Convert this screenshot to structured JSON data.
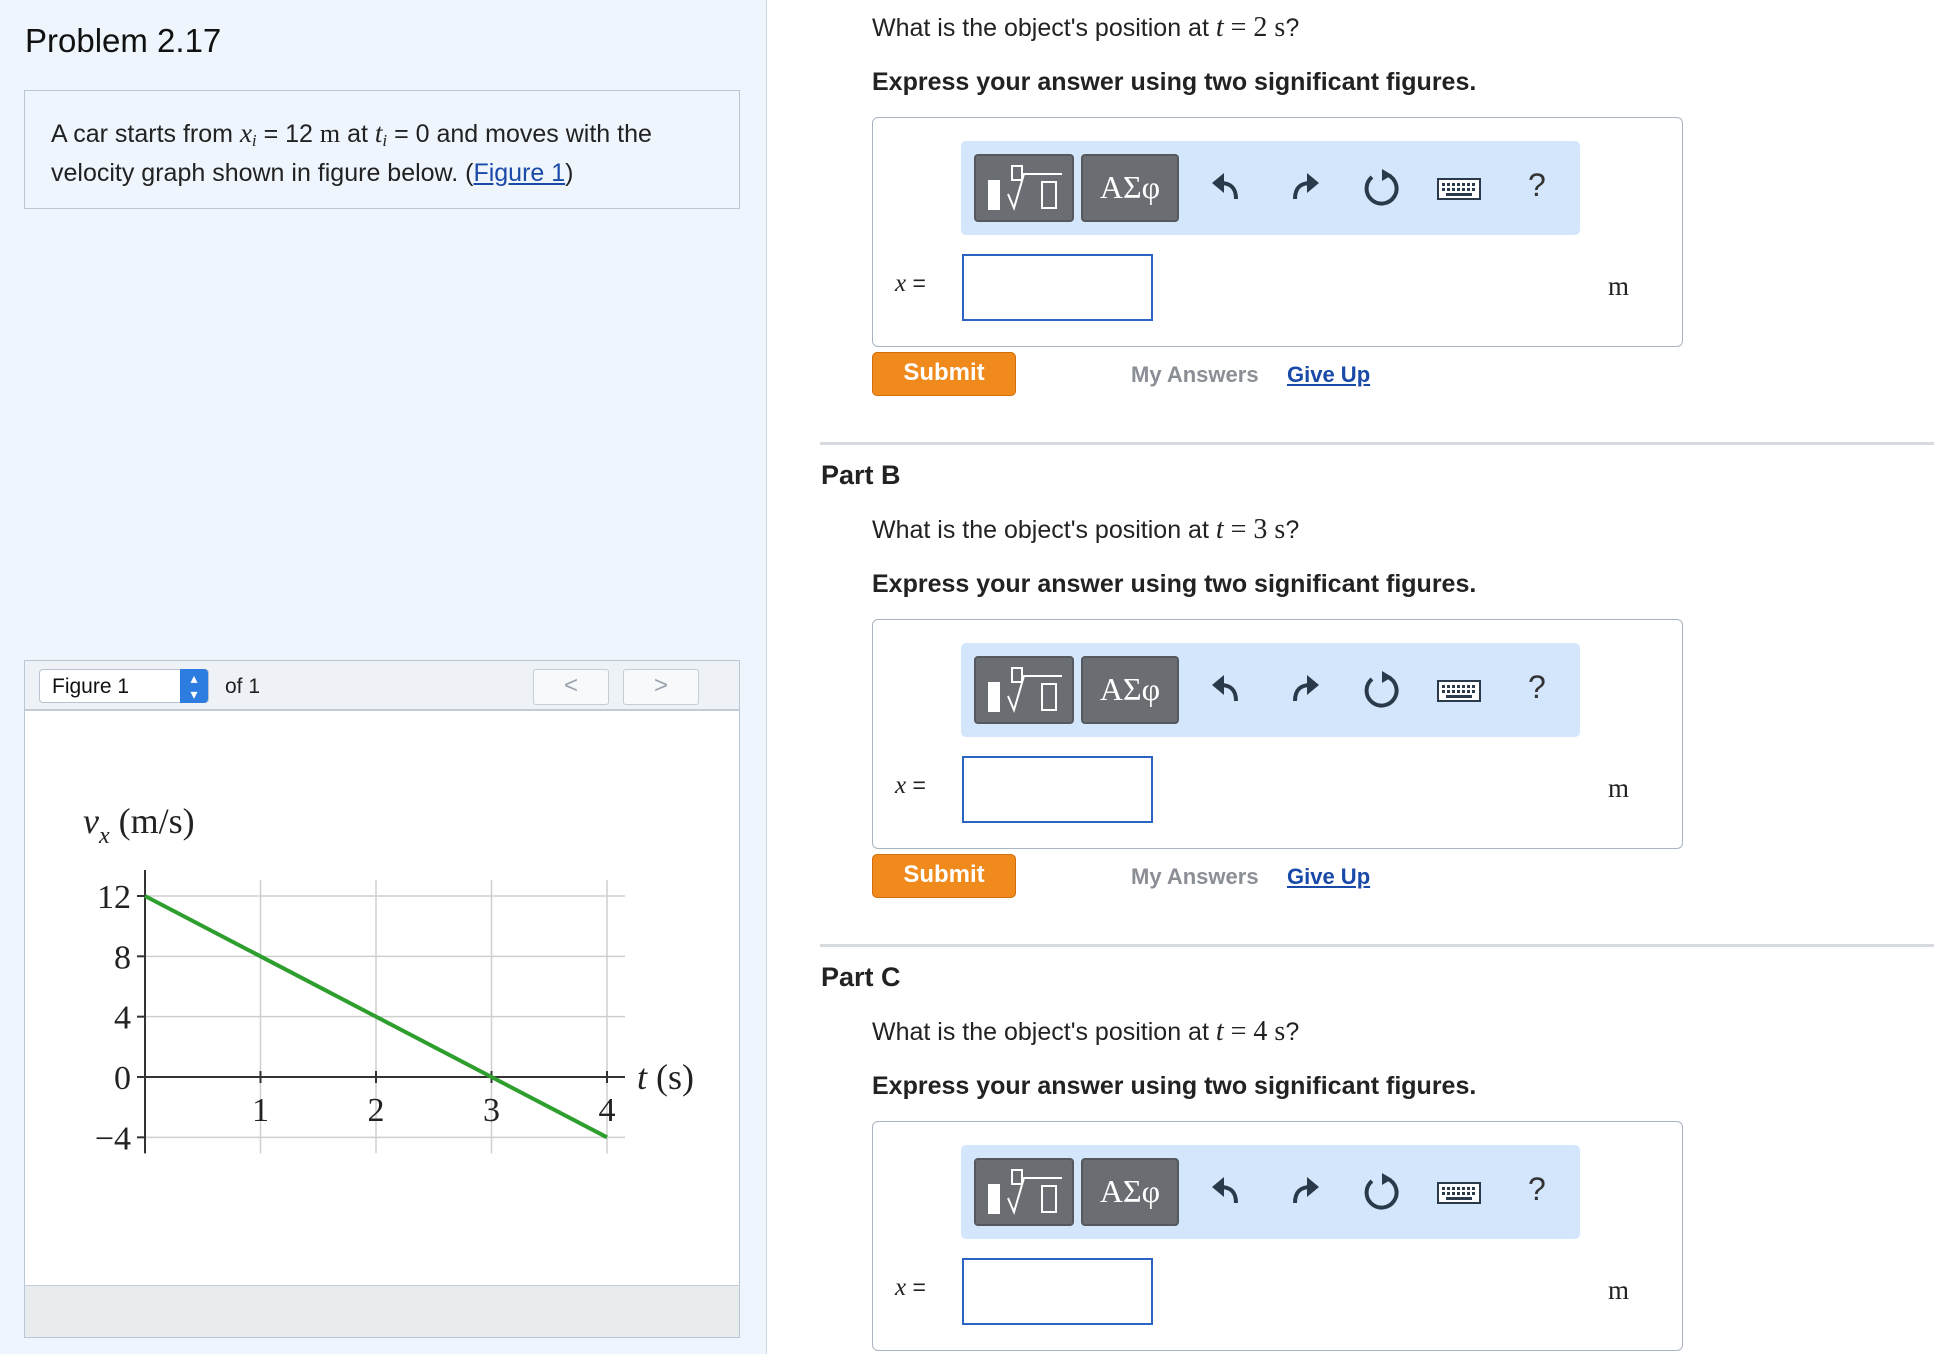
{
  "problem": {
    "title": "Problem 2.17",
    "text_1": "A car starts from ",
    "xi_var": "x",
    "xi_sub": "i",
    "text_2": " = 12 ",
    "xi_unit": "m",
    "text_3": " at ",
    "ti_var": "t",
    "ti_sub": "i",
    "text_4": " = 0 and moves with the velocity graph shown in figure below. (",
    "figure_link": "Figure 1",
    "text_5": ")"
  },
  "figure_viewer": {
    "select_value": "Figure 1",
    "of_text": "of 1",
    "prev_label": "<",
    "next_label": ">"
  },
  "chart_data": {
    "type": "line",
    "ylabel": "v",
    "ylabel_sub": "x",
    "ylabel_unit": " (m/s)",
    "xlabel": "t (s)",
    "xlim": [
      0,
      4
    ],
    "ylim": [
      -4,
      12
    ],
    "x_ticks": [
      "1",
      "2",
      "3",
      "4"
    ],
    "y_ticks": [
      "12",
      "8",
      "4",
      "0",
      "−4"
    ],
    "grid": true,
    "series": [
      {
        "x": [
          0,
          4
        ],
        "y": [
          12,
          -4
        ],
        "color": "#2e9e2e"
      }
    ]
  },
  "toolbar": {
    "greek_label": "ΑΣφ",
    "help_label": "?"
  },
  "parts": [
    {
      "question_prefix": "What is the object's position at ",
      "t_var": "t",
      "eq": " = 2 ",
      "t_unit": "s",
      "question_suffix": "?",
      "instruction": "Express your answer using two significant figures.",
      "x_var": "x",
      "x_eq": " =",
      "answer_value": "",
      "unit": "m",
      "submit_label": "Submit",
      "my_answers_label": "My Answers",
      "give_up_label": "Give Up"
    },
    {
      "title": "Part B",
      "question_prefix": "What is the object's position at ",
      "t_var": "t",
      "eq": " = 3 ",
      "t_unit": "s",
      "question_suffix": "?",
      "instruction": "Express your answer using two significant figures.",
      "x_var": "x",
      "x_eq": " =",
      "answer_value": "",
      "unit": "m",
      "submit_label": "Submit",
      "my_answers_label": "My Answers",
      "give_up_label": "Give Up"
    },
    {
      "title": "Part C",
      "question_prefix": "What is the object's position at ",
      "t_var": "t",
      "eq": " = 4 ",
      "t_unit": "s",
      "question_suffix": "?",
      "instruction": "Express your answer using two significant figures.",
      "x_var": "x",
      "x_eq": " =",
      "answer_value": "",
      "unit": "m"
    }
  ]
}
